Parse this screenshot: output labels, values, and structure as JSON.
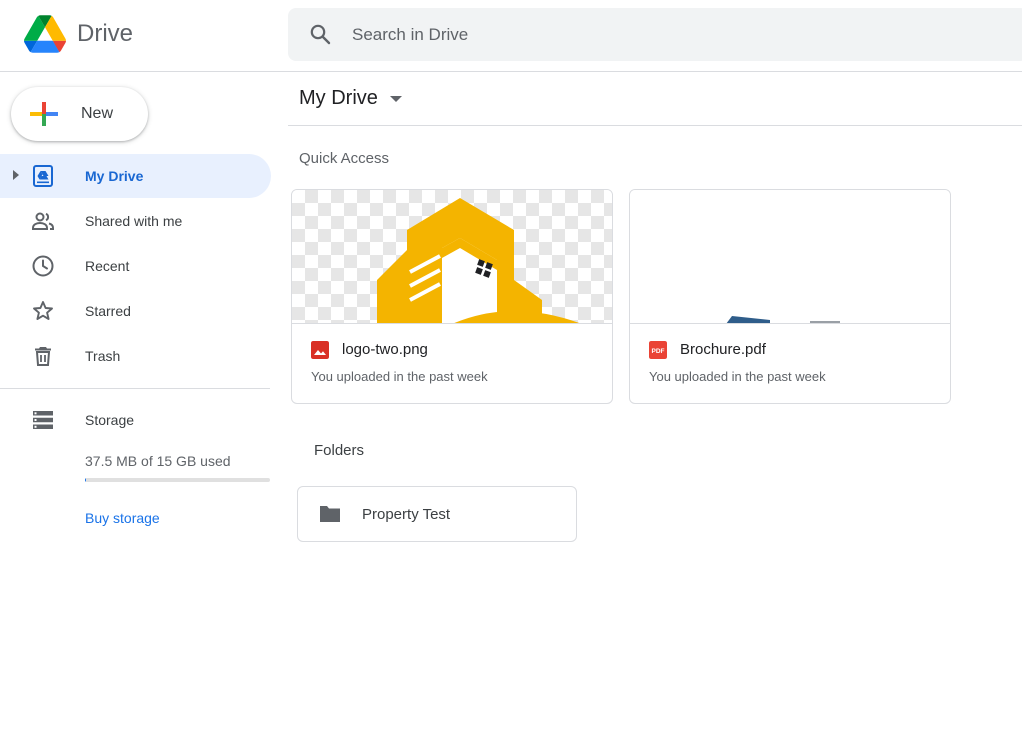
{
  "app": {
    "title": "Drive"
  },
  "search": {
    "placeholder": "Search in Drive"
  },
  "new_button": {
    "label": "New"
  },
  "sidebar": {
    "items": [
      {
        "label": "My Drive",
        "icon": "my-drive-icon",
        "active": true
      },
      {
        "label": "Shared with me",
        "icon": "shared-icon",
        "active": false
      },
      {
        "label": "Recent",
        "icon": "clock-icon",
        "active": false
      },
      {
        "label": "Starred",
        "icon": "star-icon",
        "active": false
      },
      {
        "label": "Trash",
        "icon": "trash-icon",
        "active": false
      }
    ],
    "storage": {
      "label": "Storage",
      "used_text": "37.5 MB of 15 GB used",
      "used_fraction": 0.0025,
      "buy_label": "Buy storage"
    }
  },
  "main": {
    "title": "My Drive",
    "quick_access": {
      "label": "Quick Access",
      "files": [
        {
          "name": "logo-two.png",
          "subtitle": "You uploaded in the past week",
          "type": "image",
          "icon": "image-file-icon"
        },
        {
          "name": "Brochure.pdf",
          "subtitle": "You uploaded in the past week",
          "type": "pdf",
          "icon": "pdf-file-icon"
        }
      ]
    },
    "folders": {
      "label": "Folders",
      "items": [
        {
          "name": "Property Test",
          "icon": "folder-icon"
        }
      ]
    }
  },
  "colors": {
    "accent": "#1a73e8",
    "active_bg": "#e8f0fe",
    "image_icon": "#d93025",
    "pdf_icon": "#ea4335",
    "logo_yellow": "#f4b400",
    "pdf_preview_blue": "#2f5d8a"
  }
}
